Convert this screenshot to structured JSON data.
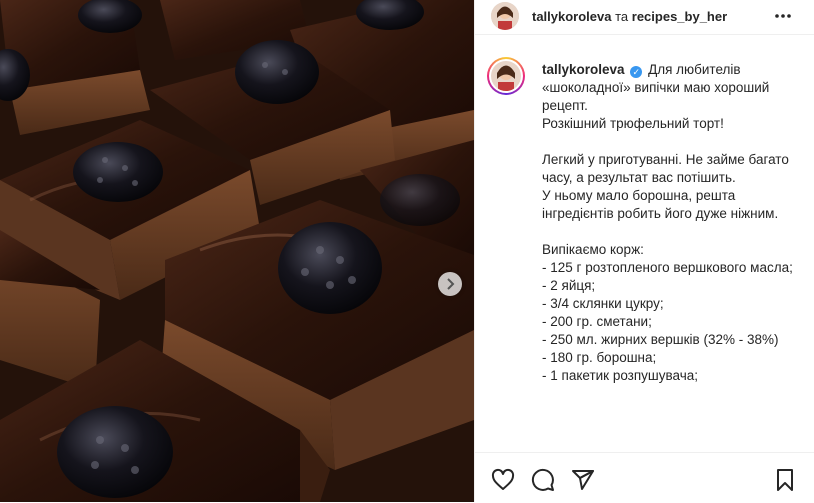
{
  "post": {
    "image_alt": "chocolate truffle cake squares with blackberries",
    "next_icon": "chevron-right-icon"
  },
  "header": {
    "author": "tallykoroleva",
    "separator": " та ",
    "coauthor": "recipes_by_her",
    "more_icon": "more-horizontal-icon"
  },
  "caption": {
    "username": "tallykoroleva",
    "verified_icon": "verified-badge-icon",
    "lines": [
      "Для любителів «шоколадної» випічки маю хороший рецепт.",
      "Розкішний трюфельний торт!",
      "",
      "Легкий у приготуванні. Не займе багато часу, а результат вас потішить.",
      "У ньому мало борошна, решта інгредієнтів робить його дуже ніжним.",
      "",
      "Випікаємо корж:",
      "- 125 г розтопленого вершкового масла;",
      "- 2 яйця;",
      "- 3/4 склянки цукру;",
      "- 200 гр. сметани;",
      "- 250 мл. жирних вершків (32% - 38%)",
      "- 180 гр. борошна;",
      "- 1 пакетик розпушувача;"
    ]
  },
  "actions": {
    "like_icon": "heart-icon",
    "comment_icon": "comment-icon",
    "share_icon": "send-icon",
    "save_icon": "bookmark-icon"
  },
  "colors": {
    "verified": "#3897f0",
    "text": "#262626",
    "border": "#efefef"
  }
}
